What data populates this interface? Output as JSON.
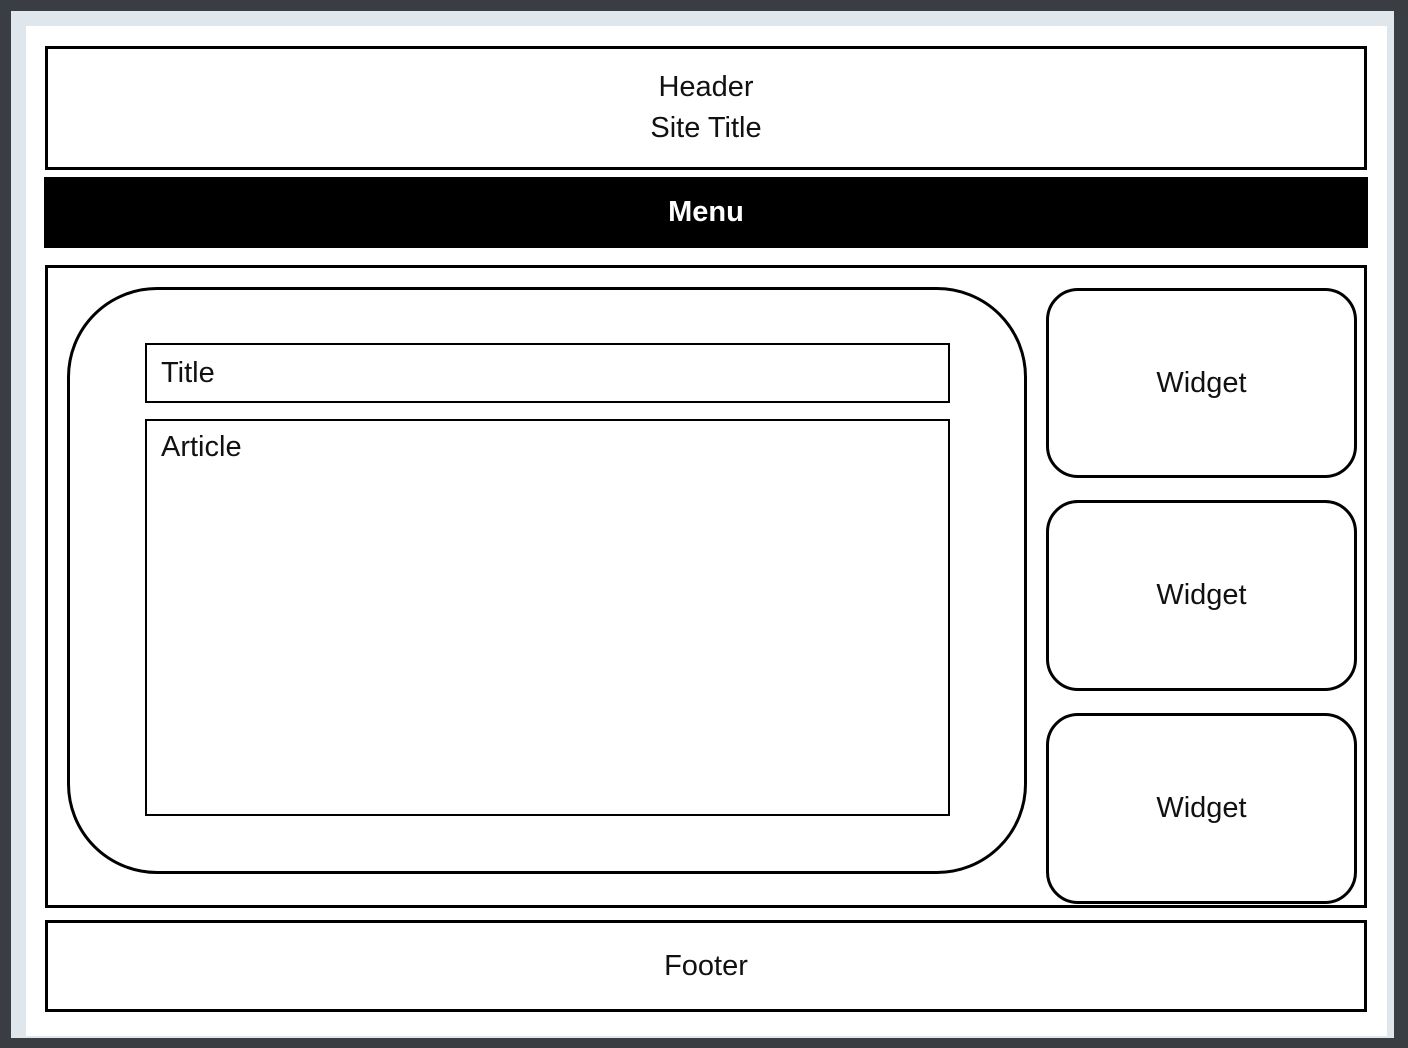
{
  "header": {
    "line1": "Header",
    "line2": "Site Title"
  },
  "menu": {
    "label": "Menu"
  },
  "main": {
    "title_label": "Title",
    "article_label": "Article"
  },
  "sidebar": {
    "widgets": [
      {
        "label": "Widget"
      },
      {
        "label": "Widget"
      },
      {
        "label": "Widget"
      }
    ]
  },
  "footer": {
    "label": "Footer"
  }
}
